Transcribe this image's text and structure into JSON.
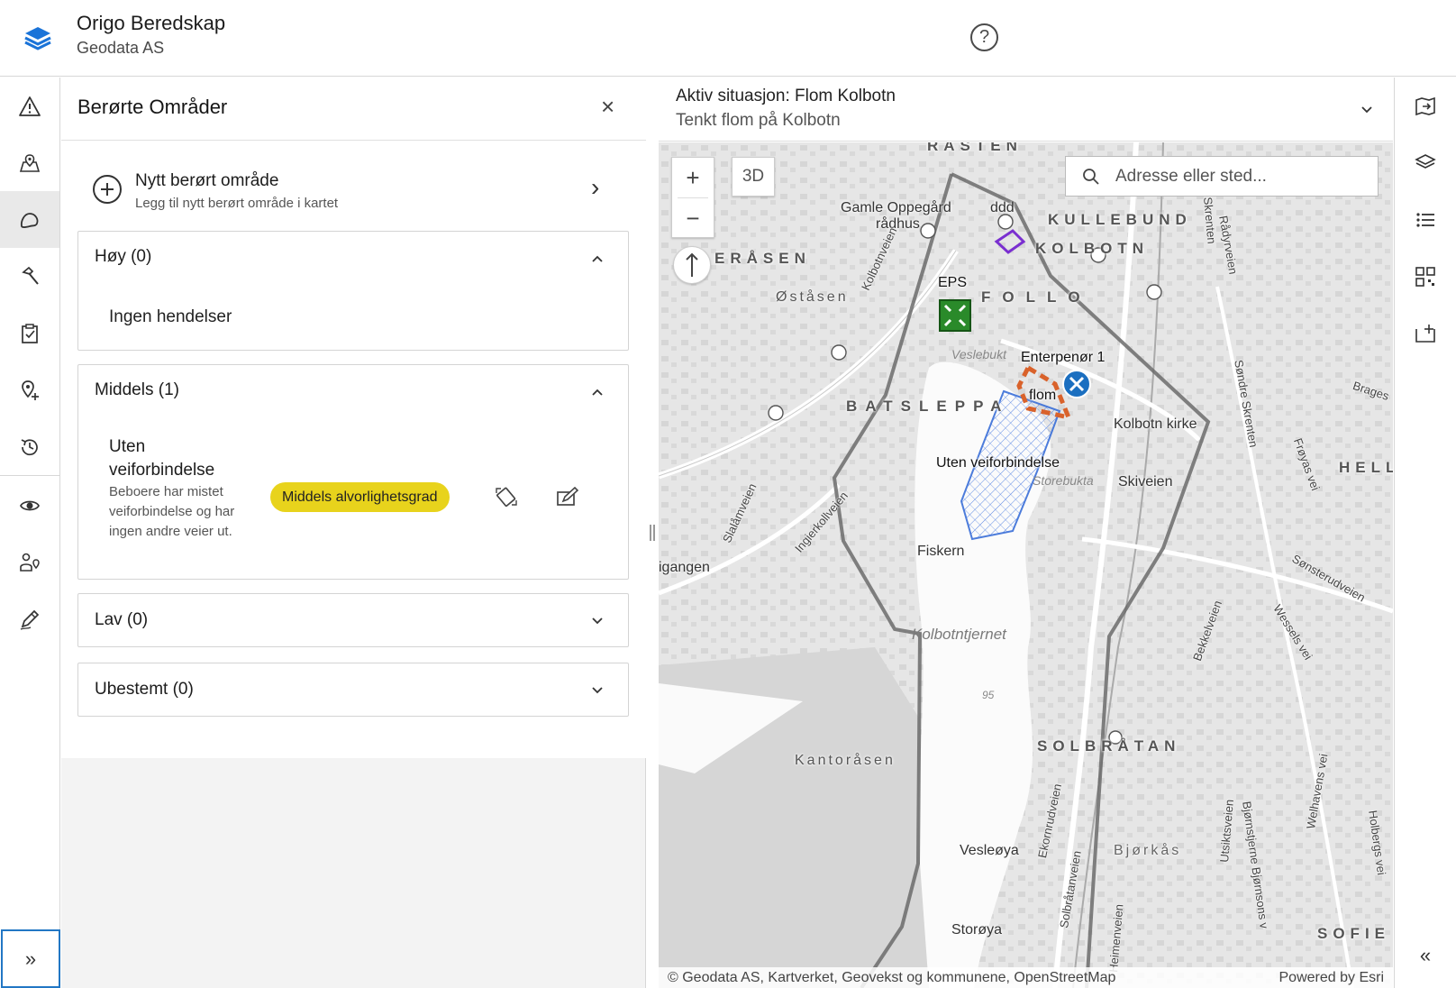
{
  "header": {
    "app_title": "Origo Beredskap",
    "org_name": "Geodata AS",
    "help_icon": "question-circle-icon",
    "help_label": "?"
  },
  "left_actions": [
    {
      "icon": "warning-icon"
    },
    {
      "icon": "map-pin-icon"
    },
    {
      "icon": "affected-area-icon",
      "active": true
    },
    {
      "icon": "hammer-icon"
    },
    {
      "icon": "clipboard-check-icon"
    },
    {
      "icon": "add-location-icon"
    },
    {
      "icon": "history-icon"
    },
    {
      "icon": "eye-icon"
    },
    {
      "icon": "person-location-icon"
    },
    {
      "icon": "pen-icon"
    }
  ],
  "panel": {
    "title": "Berørte Områder",
    "close_label": "×",
    "new_area": {
      "title": "Nytt berørt område",
      "subtitle": "Legg til nytt berørt område i kartet",
      "chevron": "›"
    },
    "groups": {
      "hoy": {
        "title": "Høy (0)",
        "empty_text": "Ingen hendelser"
      },
      "middels": {
        "title": "Middels (1)",
        "item": {
          "title": "Uten veiforbindelse",
          "description": "Beboere har mistet veiforbindelse og har ingen andre veier ut.",
          "badge": "Middels alvorlighetsgrad",
          "badge_color": "#e8d31c"
        }
      },
      "lav": {
        "title": "Lav (0)"
      },
      "ubestemt": {
        "title": "Ubestemt (0)"
      }
    }
  },
  "situation": {
    "title": "Aktiv situasjon: Flom Kolbotn",
    "subtitle": "Tenkt flom på Kolbotn"
  },
  "map": {
    "zoom_in": "+",
    "zoom_out": "−",
    "btn_3d": "3D",
    "compass": "↑",
    "search_placeholder": "Adresse eller sted...",
    "attribution": "Geodata AS, Kartverket, Geovekst og kommunene, OpenStreetMap",
    "powered_by": "Powered by Esri",
    "labels": {
      "rasten": "RASTEN",
      "kullebund": "KULLEBUND",
      "kolbotn": "KOLBOTN",
      "erasen": "ERÅSEN",
      "follo": "FOLLO",
      "batsleppa": "BATSLEPPA",
      "hell": "HELL",
      "solbratan": "SOLBRÅTAN",
      "sofie": "SOFIE",
      "bjorkas": "Bjørkås",
      "kantorasen": "Kantoråsen",
      "ostasen": "Øståsen",
      "gamle_oppegard": "Gamle Oppegård",
      "radhus": "rådhus",
      "ddd": "ddd",
      "eps": "EPS",
      "entreprenor": "Enterpenør 1",
      "flom": "flom",
      "uten_vei": "Uten veiforbindelse",
      "storebukta": "Storebukta",
      "veslebukta": "Veslebukt",
      "skiveien": "Skiveien",
      "kolbotn_kirke": "Kolbotn kirke",
      "fiskern": "Fiskern",
      "kolbotntjernet": "Kolbotntjernet",
      "depth_95": "95",
      "vesleoya": "Vesleøya",
      "storoya": "Storøya",
      "igangen": "igangen",
      "brages": "Brages",
      "sondre_skrenten": "Søndre Skrenten",
      "froyas_vei": "Frøyas vei",
      "sonsterudveien": "Sønsterudveien",
      "wessels_vei": "Wessels vei",
      "bekkelveien": "Bekkelveien",
      "kolbotnveien": "Kolbotnveien",
      "slalamveien": "Slalåmveien",
      "ingierkollveien": "Ingierkollveien",
      "radyrveien": "Rådyrveien",
      "skrenten": "Skrenten",
      "ekornrudveien": "Ekornrudveien",
      "solbratanveien": "Solbråtanveien",
      "heimenveien": "Heimenveien",
      "utsiktsveien": "Utsiktsveien",
      "bjornstjerne": "Bjørnstjerne Bjørnsons v",
      "welhavens_vei": "Welhavens vei",
      "holbergs_vei": "Holbergs vei"
    },
    "colors": {
      "boundary": "#6b6b6b",
      "area_polygon": "#3a6fd8",
      "flood_marker": "#d9622b",
      "entreprenor_marker": "#1b6fc0",
      "eps_marker": "#2a8a2a",
      "ddd_marker": "#7a2fd0"
    }
  },
  "right_actions": [
    {
      "icon": "map-export-icon"
    },
    {
      "icon": "layers-icon"
    },
    {
      "icon": "legend-list-icon"
    },
    {
      "icon": "qr-code-icon"
    },
    {
      "icon": "map-add-icon"
    }
  ]
}
